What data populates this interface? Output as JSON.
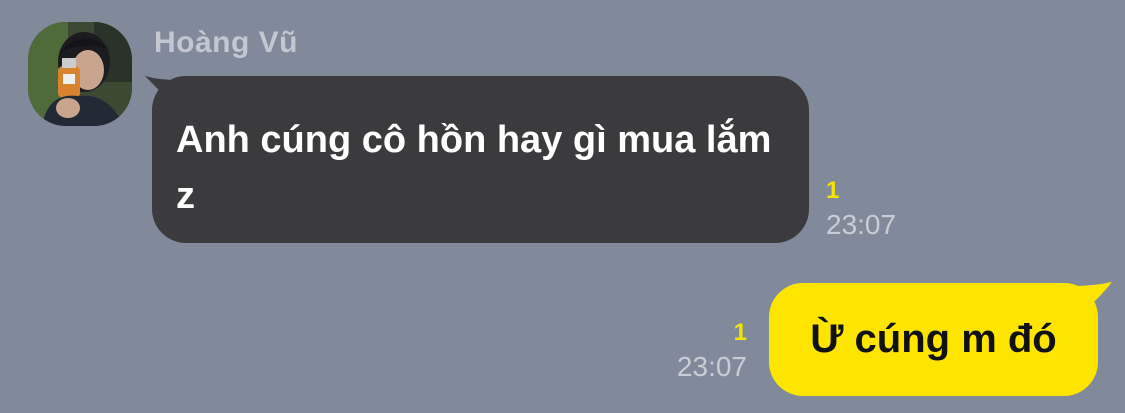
{
  "theme": {
    "background": "#808a9b",
    "incoming_bubble": "#3b3b3d",
    "outgoing_bubble": "#fee500",
    "unread_color": "#f5e400",
    "time_color": "#c9cdd4"
  },
  "messages": [
    {
      "direction": "incoming",
      "sender": "Hoàng Vũ",
      "avatar_icon": "profile-photo",
      "text": "Anh cúng cô hồn hay gì mua lắm z",
      "unread": "1",
      "time": "23:07"
    },
    {
      "direction": "outgoing",
      "text": "Ừ cúng m đó",
      "unread": "1",
      "time": "23:07"
    }
  ]
}
